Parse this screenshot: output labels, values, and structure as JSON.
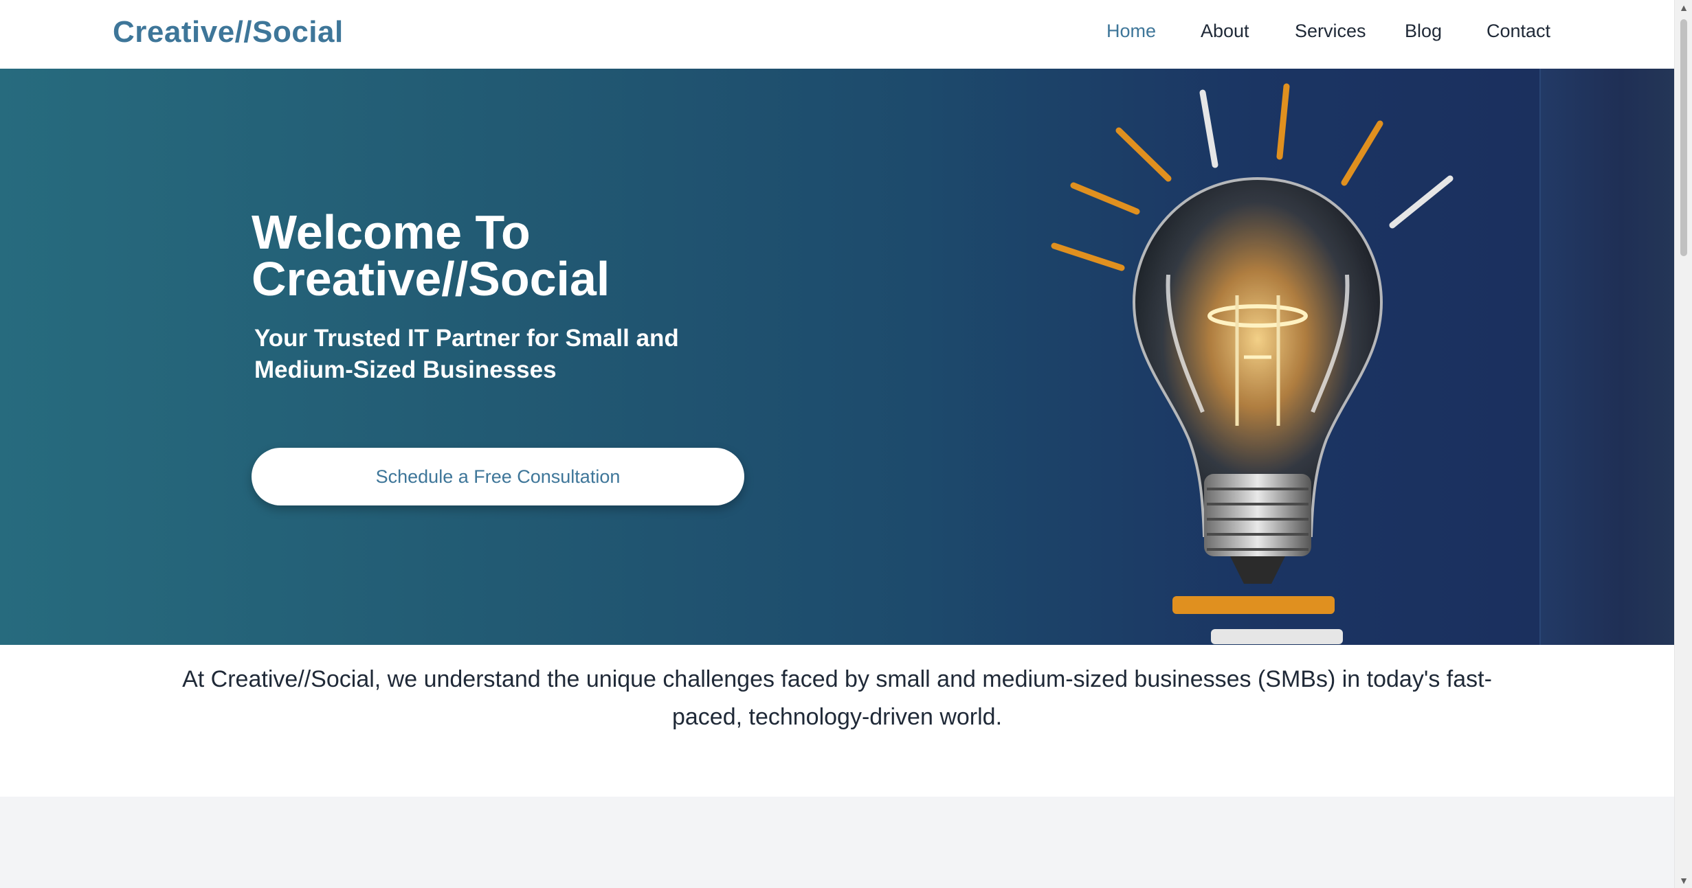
{
  "header": {
    "logo": "Creative//Social",
    "nav": [
      {
        "label": "Home",
        "active": true
      },
      {
        "label": "About",
        "active": false
      },
      {
        "label": "Services",
        "active": false
      },
      {
        "label": "Blog",
        "active": false
      },
      {
        "label": "Contact",
        "active": false
      }
    ]
  },
  "hero": {
    "title_line1": "Welcome To",
    "title_line2": "Creative//Social",
    "subtitle": "Your Trusted IT Partner for Small and Medium-Sized Businesses",
    "cta_label": "Schedule a Free Consultation",
    "image_icon": "lightbulb-icon"
  },
  "intro": {
    "text": "At Creative//Social, we understand the unique challenges faced by small and medium-sized businesses (SMBs) in today's fast-paced, technology-driven world."
  },
  "colors": {
    "brand": "#3e7699",
    "hero_start": "#276b7e",
    "hero_end": "#1b2d5c",
    "accent_orange": "#e0901f",
    "gray_section": "#f3f4f6"
  }
}
